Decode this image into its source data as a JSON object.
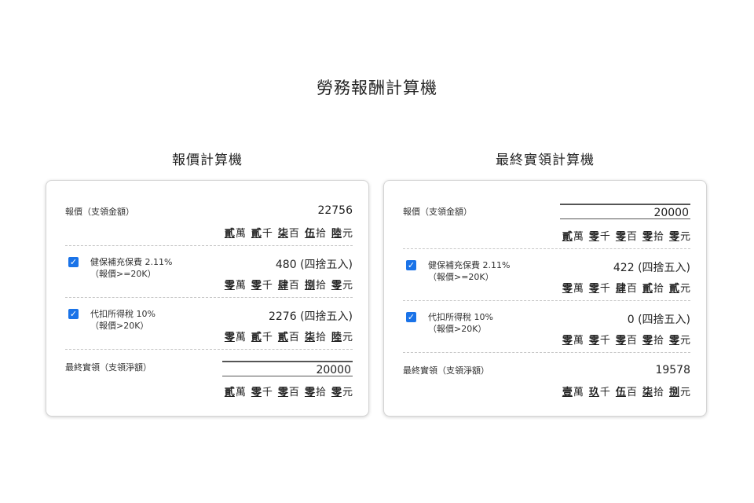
{
  "page_title": "勞務報酬計算機",
  "left": {
    "title": "報價計算機",
    "gross": {
      "label": "報價（支領金額）",
      "value": "22756",
      "digits": [
        [
          "貳",
          "萬"
        ],
        [
          "貳",
          "千"
        ],
        [
          "柒",
          "百"
        ],
        [
          "伍",
          "拾"
        ],
        [
          "陸",
          "元"
        ]
      ]
    },
    "insurance": {
      "label": "健保補充保費 2.11%",
      "sub": "（報價>=20K）",
      "checked": true,
      "value": "480 (四捨五入)",
      "digits": [
        [
          "零",
          "萬"
        ],
        [
          "零",
          "千"
        ],
        [
          "肆",
          "百"
        ],
        [
          "捌",
          "拾"
        ],
        [
          "零",
          "元"
        ]
      ]
    },
    "tax": {
      "label": "代扣所得稅 10%",
      "sub": "（報價>20K）",
      "checked": true,
      "value": "2276 (四捨五入)",
      "digits": [
        [
          "零",
          "萬"
        ],
        [
          "貳",
          "千"
        ],
        [
          "貳",
          "百"
        ],
        [
          "柒",
          "拾"
        ],
        [
          "陸",
          "元"
        ]
      ]
    },
    "net": {
      "label": "最終實領（支領淨額）",
      "value": "20000",
      "digits": [
        [
          "貳",
          "萬"
        ],
        [
          "零",
          "千"
        ],
        [
          "零",
          "百"
        ],
        [
          "零",
          "拾"
        ],
        [
          "零",
          "元"
        ]
      ]
    }
  },
  "right": {
    "title": "最終實領計算機",
    "gross": {
      "label": "報價（支領金額）",
      "value": "20000",
      "digits": [
        [
          "貳",
          "萬"
        ],
        [
          "零",
          "千"
        ],
        [
          "零",
          "百"
        ],
        [
          "零",
          "拾"
        ],
        [
          "零",
          "元"
        ]
      ]
    },
    "insurance": {
      "label": "健保補充保費 2.11%",
      "sub": "（報價>=20K）",
      "checked": true,
      "value": "422 (四捨五入)",
      "digits": [
        [
          "零",
          "萬"
        ],
        [
          "零",
          "千"
        ],
        [
          "肆",
          "百"
        ],
        [
          "貳",
          "拾"
        ],
        [
          "貳",
          "元"
        ]
      ]
    },
    "tax": {
      "label": "代扣所得稅 10%",
      "sub": "（報價>20K）",
      "checked": true,
      "value": "0 (四捨五入)",
      "digits": [
        [
          "零",
          "萬"
        ],
        [
          "零",
          "千"
        ],
        [
          "零",
          "百"
        ],
        [
          "零",
          "拾"
        ],
        [
          "零",
          "元"
        ]
      ]
    },
    "net": {
      "label": "最終實領（支領淨額）",
      "value": "19578",
      "digits": [
        [
          "壹",
          "萬"
        ],
        [
          "玖",
          "千"
        ],
        [
          "伍",
          "百"
        ],
        [
          "柒",
          "拾"
        ],
        [
          "捌",
          "元"
        ]
      ]
    }
  },
  "colors": {
    "checkbox": "#1a73e8",
    "card_border": "#d4d4d4"
  }
}
